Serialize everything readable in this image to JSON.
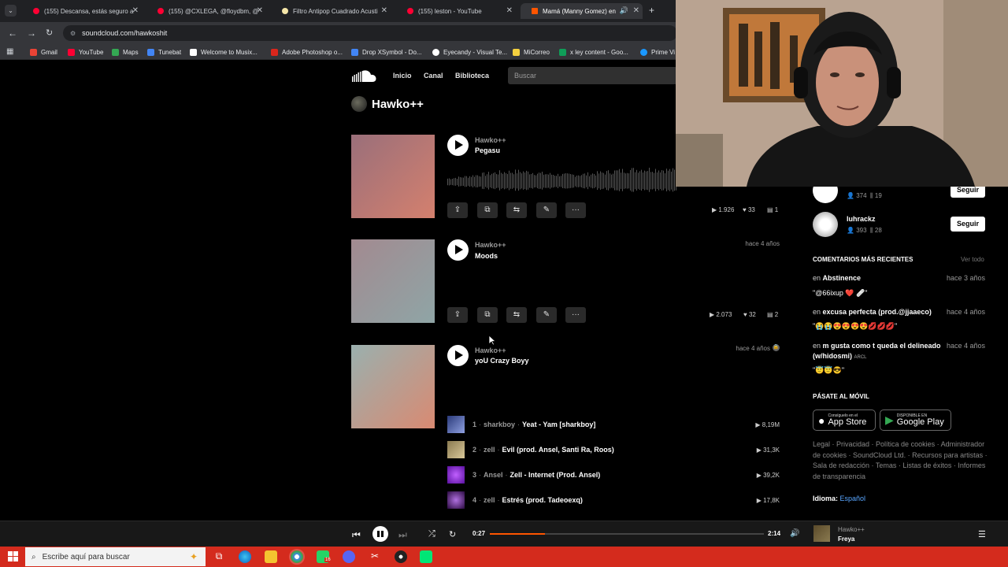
{
  "browser": {
    "tabs": [
      {
        "label": "(155) Descansa, estás seguro a",
        "fav": "youtube-icon",
        "color": "#ff0033"
      },
      {
        "label": "(155) @CXLEGA, @floydbm, @",
        "fav": "youtube-icon",
        "color": "#ff0033"
      },
      {
        "label": "Filtro Antipop Cuadrado Acusti",
        "fav": "shop-icon",
        "color": "#f5e6a8"
      },
      {
        "label": "(155) leston - YouTube",
        "fav": "youtube-icon",
        "color": "#ff0033"
      },
      {
        "label": "Mamá (Manny Gomez) en",
        "fav": "soundcloud-icon",
        "color": "#ff5500"
      }
    ],
    "url": "soundcloud.com/hawkoshit",
    "bookmarks": [
      {
        "label": "Gmail",
        "color": "#ea4335"
      },
      {
        "label": "YouTube",
        "color": "#ff0033"
      },
      {
        "label": "Maps",
        "color": "#34a853"
      },
      {
        "label": "Tunebat",
        "color": "#4285f4"
      },
      {
        "label": "Welcome to Musix...",
        "color": "#ffffff"
      },
      {
        "label": "Adobe Photoshop o...",
        "color": "#d9261c"
      },
      {
        "label": "Drop XSymbol - Do...",
        "color": "#4285f4"
      },
      {
        "label": "Eyecandy - Visual Te...",
        "color": "#ffffff"
      },
      {
        "label": "MiCorreo",
        "color": "#f4d03f"
      },
      {
        "label": "x ley content - Goo...",
        "color": "#0f9d58"
      },
      {
        "label": "Prime Vi",
        "color": "#1a98ff"
      }
    ]
  },
  "sc_header": {
    "nav": [
      "Inicio",
      "Canal",
      "Biblioteca"
    ],
    "search_placeholder": "Buscar"
  },
  "profile": {
    "name": "Hawko++"
  },
  "tracks": [
    {
      "artist": "Hawko++",
      "title": "Pegasu",
      "date": "",
      "plays": "1.926",
      "likes": "33",
      "comments": "1",
      "art": [
        "#9a6f7a",
        "#d4806e"
      ]
    },
    {
      "artist": "Hawko++",
      "title": "Moods",
      "date": "hace 4 años",
      "plays": "2.073",
      "likes": "32",
      "comments": "2",
      "art": [
        "#a28a90",
        "#8fa5a6"
      ]
    },
    {
      "artist": "Hawko++",
      "title": "yoU Crazy Boyy",
      "date": "hace 4 años",
      "art": [
        "#9ab0ae",
        "#d98a72"
      ]
    }
  ],
  "playlist": [
    {
      "num": "1",
      "artist": "sharkboy",
      "title": "Yeat - Yam [sharkboy]",
      "plays": "8,19M",
      "thumb": "#3c4a8a"
    },
    {
      "num": "2",
      "artist": "zell",
      "title": "Evil (prod. Ansel, Santi Ra, Roos)",
      "plays": "31,3K",
      "thumb": "#bfa67a"
    },
    {
      "num": "3",
      "artist": "Ansel",
      "title": "Zell - Internet (Prod. Ansel)",
      "plays": "39,2K",
      "thumb": "#8a2be2"
    },
    {
      "num": "4",
      "artist": "zell",
      "title": "Estrés (prod. Tadeoexq)",
      "plays": "17,8K",
      "thumb": "#4a2a6a"
    }
  ],
  "sidebar": {
    "follows": [
      {
        "name": "",
        "followers": "374",
        "tracks": "19",
        "button": "Seguir"
      },
      {
        "name": "luhrackz",
        "followers": "393",
        "tracks": "28",
        "button": "Seguir"
      }
    ],
    "comments_header": "COMENTARIOS MÁS RECIENTES",
    "see_all": "Ver todo",
    "comments": [
      {
        "prefix": "en",
        "track": "Abstinence",
        "time": "hace 3 años",
        "text": "\"@66ixup ❤️ 🩹\""
      },
      {
        "prefix": "en",
        "track": "excusa perfecta (prod.@jjaaeco)",
        "time": "hace 4 años",
        "text": "\"😭😭😍😍😍😍💋💋💋\""
      },
      {
        "prefix": "en",
        "track": "m gusta como t queda el delineado (w/hidosmi)",
        "tag": "ARCL",
        "time": "hace 4 años",
        "text": "\"😇😇😎\""
      }
    ],
    "mobile_header": "PÁSATE AL MÓVIL",
    "app_store": {
      "small": "Consíguelo en el",
      "big": "App Store"
    },
    "google_play": {
      "small": "DISPONIBLE EN",
      "big": "Google Play"
    },
    "footer_links": "Legal · Privacidad · Política de cookies · Administrador de cookies · SoundCloud Ltd. · Recursos para artistas · Sala de redacción · Temas · Listas de éxitos · Informes de transparencia",
    "language_label": "Idioma:",
    "language_value": "Español"
  },
  "player": {
    "current_time": "0:27",
    "end_time": "2:14",
    "progress": 0.2,
    "artist": "Hawko++",
    "title": "Freya"
  },
  "taskbar": {
    "search_placeholder": "Escribe aquí para buscar",
    "badge": "16"
  }
}
